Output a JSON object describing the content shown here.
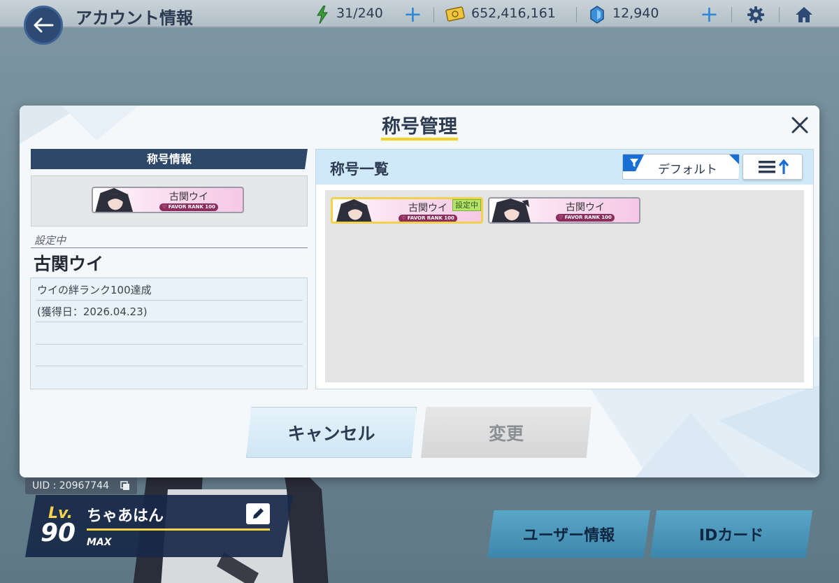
{
  "header": {
    "title": "アカウント情報",
    "ap": "31/240",
    "credits": "652,416,161",
    "gems": "12,940"
  },
  "dialog": {
    "title": "称号管理",
    "left": {
      "header": "称号情報",
      "setting_label": "設定中",
      "current_title": "古関ウイ",
      "description_lines": [
        "ウイの絆ランク100達成",
        "(獲得日：2026.04.23)"
      ]
    },
    "right": {
      "header": "称号一覧",
      "filter_label": "デフォルト"
    },
    "plates": [
      {
        "name": "古関ウイ",
        "rank": "FAVOR RANK 100",
        "badge": "設定中"
      },
      {
        "name": "古関ウイ",
        "rank": "FAVOR RANK 100"
      }
    ],
    "preview_plate": {
      "name": "古関ウイ",
      "rank": "FAVOR RANK 100"
    },
    "cancel_label": "キャンセル",
    "change_label": "変更"
  },
  "profile": {
    "uid": "UID : 20967744",
    "lv_label": "Lv.",
    "level": "90",
    "name": "ちゃあはん",
    "max_label": "MAX"
  },
  "buttons": {
    "user_info": "ユーザー情報",
    "id_card": "IDカード"
  },
  "colors": {
    "accent_blue": "#2f86d6",
    "title_underline": "#f3d322",
    "selected_border": "#f0d24b",
    "badge_green": "#b5e36c"
  }
}
